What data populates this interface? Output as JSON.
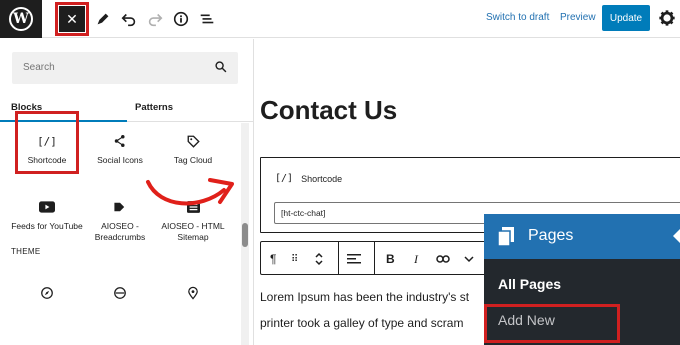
{
  "topbar": {
    "close_symbol": "✕",
    "switch_to_draft": "Switch to draft",
    "preview": "Preview",
    "update": "Update",
    "icons": [
      "wordpress-logo",
      "close-icon",
      "pencil-icon",
      "undo-icon",
      "redo-icon",
      "info-icon",
      "list-view-icon",
      "gear-icon"
    ]
  },
  "inserter": {
    "search_placeholder": "Search",
    "tabs": [
      "Blocks",
      "Patterns"
    ],
    "blocks": [
      {
        "label": "Shortcode",
        "icon": "shortcode-icon"
      },
      {
        "label": "Social Icons",
        "icon": "share-icon"
      },
      {
        "label": "Tag Cloud",
        "icon": "tag-icon"
      },
      {
        "label": "Feeds for YouTube",
        "icon": "youtube-icon"
      },
      {
        "label": "AIOSEO - Breadcrumbs",
        "icon": "breadcrumbs-icon"
      },
      {
        "label": "AIOSEO - HTML Sitemap",
        "icon": "sitemap-icon"
      }
    ],
    "section_theme": "THEME",
    "shortcode_glyph": "[/]"
  },
  "editor": {
    "page_title": "Contact Us",
    "shortcode_block_title": "Shortcode",
    "shortcode_glyph": "[/]",
    "shortcode_value": "[ht-ctc-chat]",
    "paragraph_line1": "Lorem Ipsum has been the industry's st",
    "paragraph_line2": "printer took a galley of type and scram",
    "toolbar_bold": "B",
    "toolbar_italic": "I"
  },
  "pages_menu": {
    "title": "Pages",
    "all_pages": "All Pages",
    "add_new": "Add New"
  },
  "colors": {
    "accent": "#007cba",
    "highlight": "#d02020",
    "admin_dark": "#23282d",
    "admin_blue": "#2271b1"
  }
}
